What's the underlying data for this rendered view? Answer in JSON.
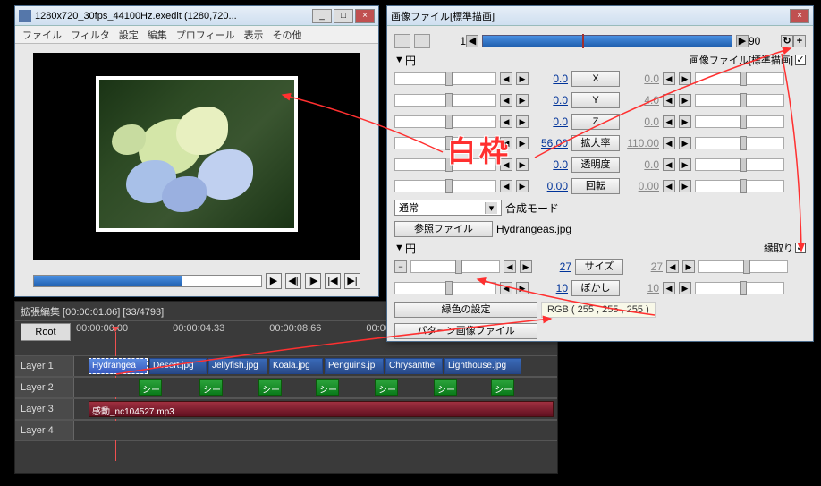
{
  "preview": {
    "title": "1280x720_30fps_44100Hz.exedit (1280,720...",
    "menus": [
      "ファイル",
      "フィルタ",
      "設定",
      "編集",
      "プロフィール",
      "表示",
      "その他"
    ]
  },
  "timeline": {
    "title": "拡張編集 [00:00:01.06] [33/4793]",
    "root": "Root",
    "times": [
      "00:00:00.00",
      "00:00:04.33",
      "00:00:08.66",
      "00:00:"
    ],
    "layers": [
      "Layer 1",
      "Layer 2",
      "Layer 3",
      "Layer 4"
    ],
    "l1": [
      "Hydrangea",
      "Desert.jpg",
      "Jellyfish.jpg",
      "Koala.jpg",
      "Penguins.jp",
      "Chrysanthe",
      "Lighthouse.jpg"
    ],
    "l2_label": "シー",
    "l3": "感動_nc104527.mp3"
  },
  "prop": {
    "title": "画像ファイル[標準描画]",
    "frame_start": "1",
    "frame_end": "90",
    "section1": "円",
    "section1_label": "画像ファイル[標準描画]",
    "rows": [
      {
        "l": "0.0",
        "btn": "X",
        "r": "0.0"
      },
      {
        "l": "0.0",
        "btn": "Y",
        "r": "4.0"
      },
      {
        "l": "0.0",
        "btn": "Z",
        "r": "0.0"
      },
      {
        "l": "56.00",
        "btn": "拡大率",
        "r": "110.00"
      },
      {
        "l": "0.0",
        "btn": "透明度",
        "r": "0.0"
      },
      {
        "l": "0.00",
        "btn": "回転",
        "r": "0.00"
      }
    ],
    "blend_label": "合成モード",
    "blend_value": "通常",
    "ref_label": "参照ファイル",
    "ref_value": "Hydrangeas.jpg",
    "section2": "円",
    "section2_label": "縁取り",
    "row2a": {
      "l": "27",
      "btn": "サイズ",
      "r": "27"
    },
    "row2b": {
      "l": "10",
      "btn": "ぼかし",
      "r": "10"
    },
    "color_btn": "緑色の設定",
    "color_val": "RGB ( 255 , 255 , 255 )",
    "pattern_btn": "パターン画像ファイル"
  },
  "anno": {
    "text": "白枠"
  }
}
